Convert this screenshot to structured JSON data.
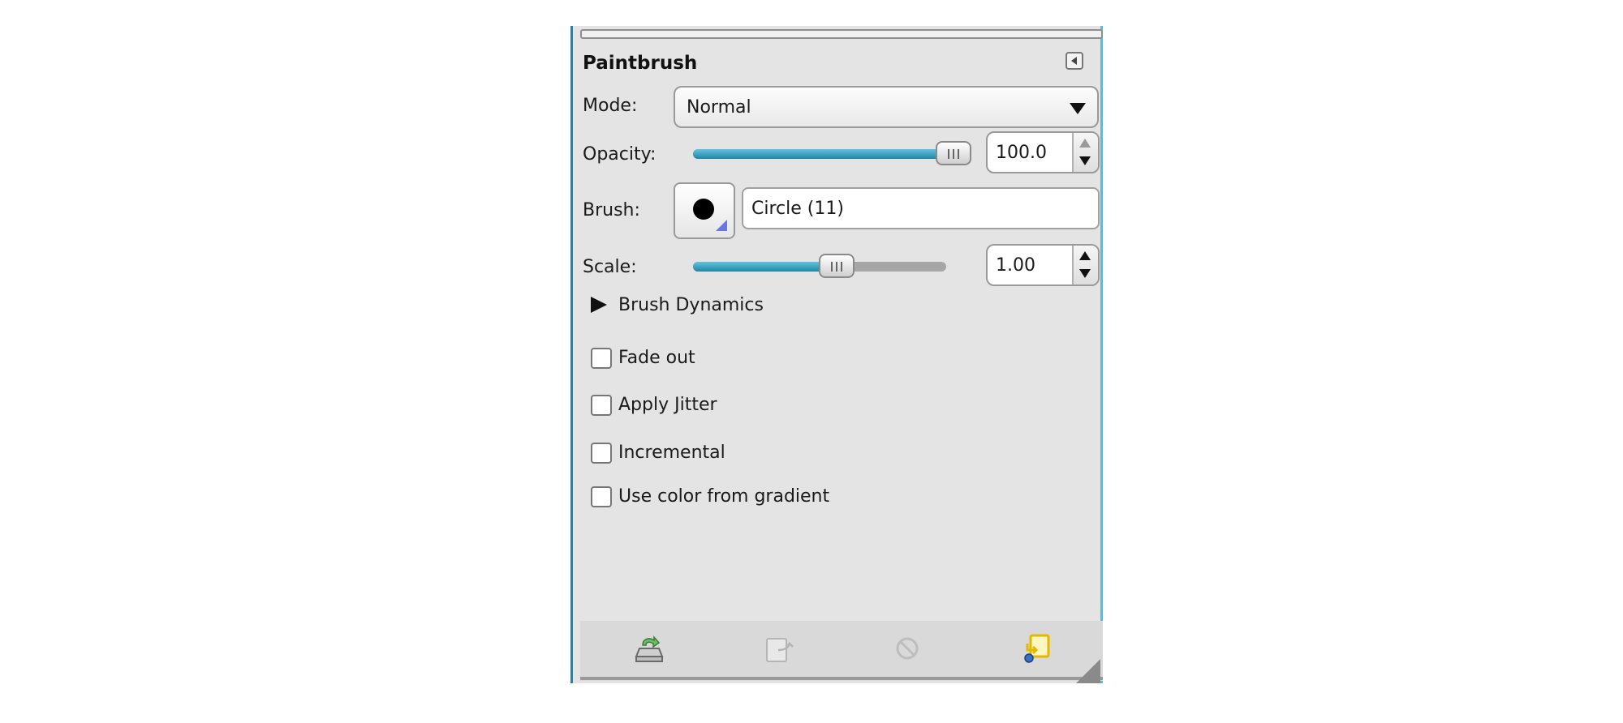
{
  "panel": {
    "title": "Paintbrush",
    "collapse_icon": "collapse-left-icon"
  },
  "mode": {
    "label": "Mode:",
    "value": "Normal"
  },
  "opacity": {
    "label": "Opacity:",
    "value": "100.0",
    "level": 1.0
  },
  "brush": {
    "label": "Brush:",
    "value": "Circle (11)",
    "preview_icon": "circle-brush-icon"
  },
  "scale": {
    "label": "Scale:",
    "value": "1.00",
    "level": 0.61
  },
  "brush_dynamics": {
    "label": "Brush Dynamics",
    "expanded": false
  },
  "options": [
    {
      "label": "Fade out",
      "checked": false
    },
    {
      "label": "Apply Jitter",
      "checked": false
    },
    {
      "label": "Incremental",
      "checked": false
    },
    {
      "label": "Use color from gradient",
      "checked": false
    }
  ],
  "footer_buttons": [
    {
      "name": "save-options-icon",
      "enabled": true
    },
    {
      "name": "restore-options-icon",
      "enabled": false
    },
    {
      "name": "delete-options-icon",
      "enabled": false
    },
    {
      "name": "reset-options-icon",
      "enabled": true
    }
  ],
  "colors": {
    "accent": "#1e87a6",
    "panel_bg": "#e4e4e4",
    "reset_icon": "#e2b800"
  }
}
